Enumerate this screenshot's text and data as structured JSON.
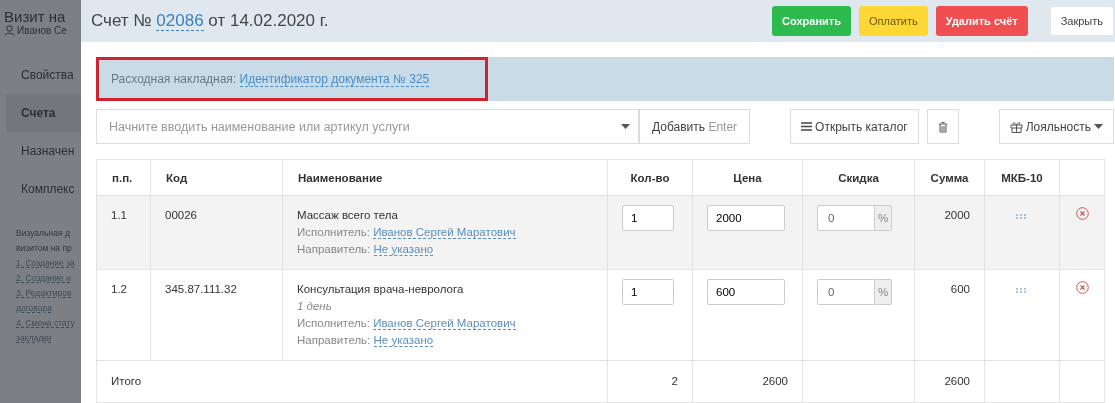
{
  "background_page": {
    "title": "Визит на",
    "user": "Иванов Се",
    "nav": [
      {
        "label": "Свойства",
        "selected": false
      },
      {
        "label": "Счета",
        "selected": true
      },
      {
        "label": "Назначен",
        "selected": false
      },
      {
        "label": "Комплекс",
        "selected": false
      }
    ],
    "help_lines": [
      "Визуальная д",
      "визитом на пр"
    ],
    "help_links": [
      "1. Создание за",
      "2. Создание н",
      "3. Редактиров",
      "договора",
      "4. Смена стату",
      "закладки"
    ]
  },
  "modal": {
    "title_prefix": "Счет №",
    "number": "02086",
    "title_suffix": "от 14.02.2020 г.",
    "buttons": [
      {
        "label": "Сохранить",
        "kind": "success"
      },
      {
        "label": "Оплатить",
        "kind": "warning"
      },
      {
        "label": "Удалить счёт",
        "kind": "danger"
      },
      {
        "label": "Закрыть",
        "kind": "default"
      }
    ],
    "notice": {
      "label": "Расходная накладная:",
      "link": "Идентификатор документа № 325",
      "highlighted": true
    },
    "search": {
      "placeholder": "Начните вводить наименование или артикул услуги"
    },
    "add_button": {
      "label": "Добавить",
      "hint": "Enter"
    },
    "catalog_button": "Открыть каталог",
    "loyalty_button": "Лояльность",
    "table": {
      "columns": [
        "п.п.",
        "Код",
        "Наименование",
        "Кол-во",
        "Цена",
        "Скидка",
        "Сумма",
        "МКБ-10"
      ],
      "rows": [
        {
          "num": "1.1",
          "code": "00026",
          "name": "Массаж всего тела",
          "performer_label": "Исполнитель:",
          "performer": "Иванов Сергей Маратович",
          "referrer_label": "Направитель:",
          "referrer": "Не указано",
          "qty": "1",
          "price": "2000",
          "discount": "0",
          "unit": "%",
          "sum": "2000",
          "selected": true
        },
        {
          "num": "1.2",
          "code": "345.87.111.32",
          "name": "Консультация врача-невролога",
          "note": "1 день",
          "performer_label": "Исполнитель:",
          "performer": "Иванов Сергей Маратович",
          "referrer_label": "Направитель:",
          "referrer": "Не указано",
          "qty": "1",
          "price": "600",
          "discount": "0",
          "unit": "%",
          "sum": "600",
          "selected": false
        }
      ],
      "total": {
        "label": "Итого",
        "qty": "2",
        "price": "2600",
        "sum": "2600"
      }
    }
  }
}
